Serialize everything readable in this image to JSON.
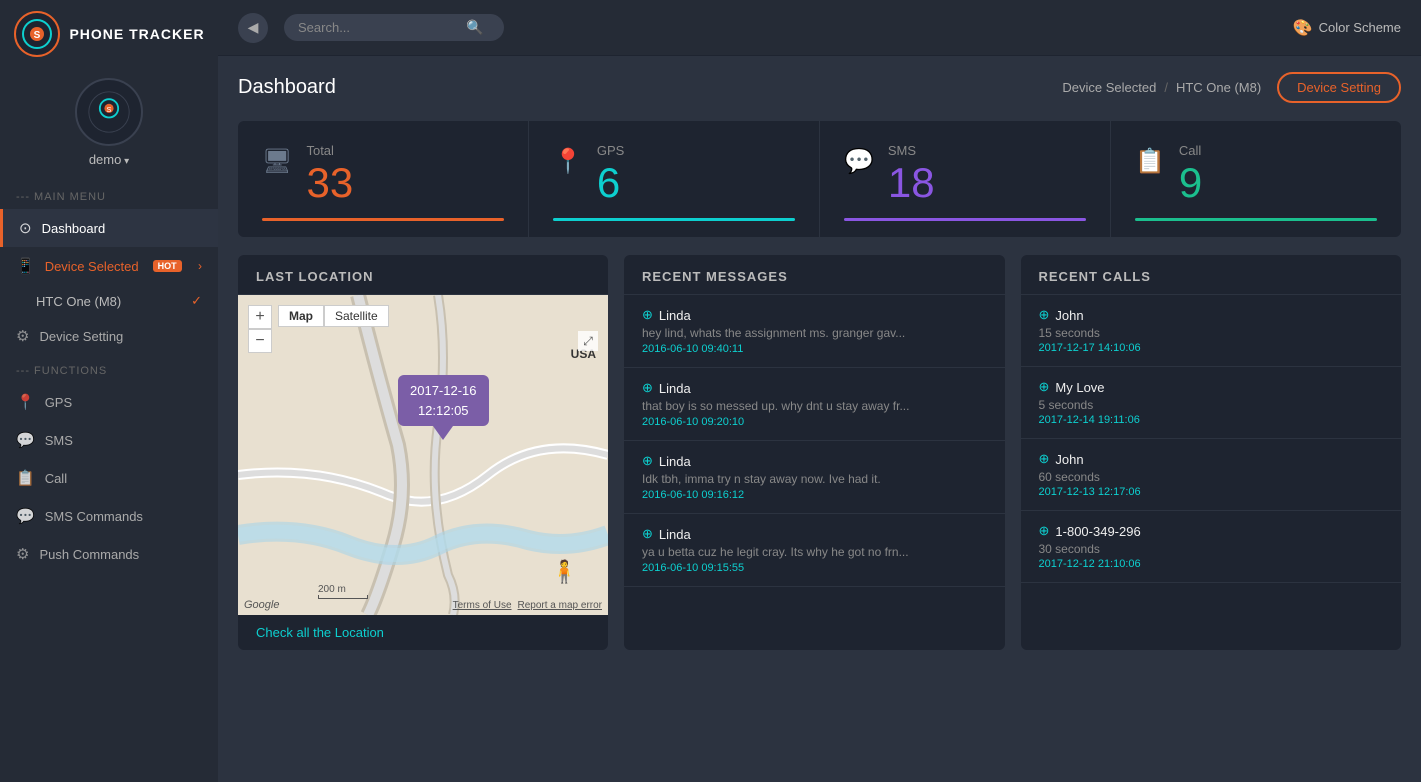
{
  "app": {
    "name": "PHONE TRACKER"
  },
  "user": {
    "name": "demo"
  },
  "topbar": {
    "search_placeholder": "Search...",
    "color_scheme_label": "Color Scheme",
    "back_icon": "◀"
  },
  "breadcrumb": {
    "device_selected": "Device Selected",
    "separator": "/",
    "device_name": "HTC One (M8)",
    "device_setting_label": "Device Setting"
  },
  "page": {
    "title": "Dashboard"
  },
  "sidebar": {
    "main_menu_label": "--- MAIN MENU",
    "functions_label": "--- FUNCTIONS",
    "items": [
      {
        "id": "dashboard",
        "label": "Dashboard",
        "icon": "⚙",
        "active": true
      },
      {
        "id": "device-selected",
        "label": "Device Selected",
        "icon": "📱",
        "badge": "HOT",
        "arrow": "›"
      },
      {
        "id": "device-name",
        "label": "HTC One (M8)",
        "check": true
      },
      {
        "id": "device-setting",
        "label": "Device Setting",
        "icon": "⚙"
      },
      {
        "id": "gps",
        "label": "GPS",
        "icon": "📍"
      },
      {
        "id": "sms",
        "label": "SMS",
        "icon": "💬"
      },
      {
        "id": "call",
        "label": "Call",
        "icon": "📋"
      },
      {
        "id": "sms-commands",
        "label": "SMS Commands",
        "icon": "💬"
      },
      {
        "id": "push-commands",
        "label": "Push Commands",
        "icon": "⚙"
      }
    ]
  },
  "stats": [
    {
      "id": "total",
      "label": "Total",
      "value": "33",
      "color": "orange",
      "icon": "🖥"
    },
    {
      "id": "gps",
      "label": "GPS",
      "value": "6",
      "color": "cyan",
      "icon": "📍"
    },
    {
      "id": "sms",
      "label": "SMS",
      "value": "18",
      "color": "purple",
      "icon": "💬"
    },
    {
      "id": "call",
      "label": "Call",
      "value": "9",
      "color": "green",
      "icon": "📋"
    }
  ],
  "map": {
    "section_title": "LAST LOCATION",
    "pin_date": "2017-12-16",
    "pin_time": "12:12:05",
    "location_text": "USA",
    "check_location_link": "Check all the Location",
    "zoom_in": "+",
    "zoom_out": "−",
    "map_tab": "Map",
    "satellite_tab": "Satellite",
    "footer_logo": "Google",
    "scale_text": "200 m",
    "terms": "Terms of Use",
    "report": "Report a map error"
  },
  "messages": {
    "section_title": "RECENT MESSAGES",
    "items": [
      {
        "name": "Linda",
        "preview": "hey lind, whats the assignment ms. granger gav...",
        "time": "2016-06-10 09:40:11"
      },
      {
        "name": "Linda",
        "preview": "that boy is so messed up. why dnt u stay away fr...",
        "time": "2016-06-10 09:20:10"
      },
      {
        "name": "Linda",
        "preview": "Idk tbh, imma try n stay away now. Ive had it.",
        "time": "2016-06-10 09:16:12"
      },
      {
        "name": "Linda",
        "preview": "ya u betta cuz he legit cray. Its why he got no frn...",
        "time": "2016-06-10 09:15:55"
      }
    ]
  },
  "calls": {
    "section_title": "RECENT CALLS",
    "items": [
      {
        "name": "John",
        "duration": "15 seconds",
        "time": "2017-12-17 14:10:06"
      },
      {
        "name": "My Love",
        "duration": "5 seconds",
        "time": "2017-12-14 19:11:06"
      },
      {
        "name": "John",
        "duration": "60 seconds",
        "time": "2017-12-13 12:17:06"
      },
      {
        "name": "1-800-349-296",
        "duration": "30 seconds",
        "time": "2017-12-12 21:10:06"
      }
    ]
  }
}
